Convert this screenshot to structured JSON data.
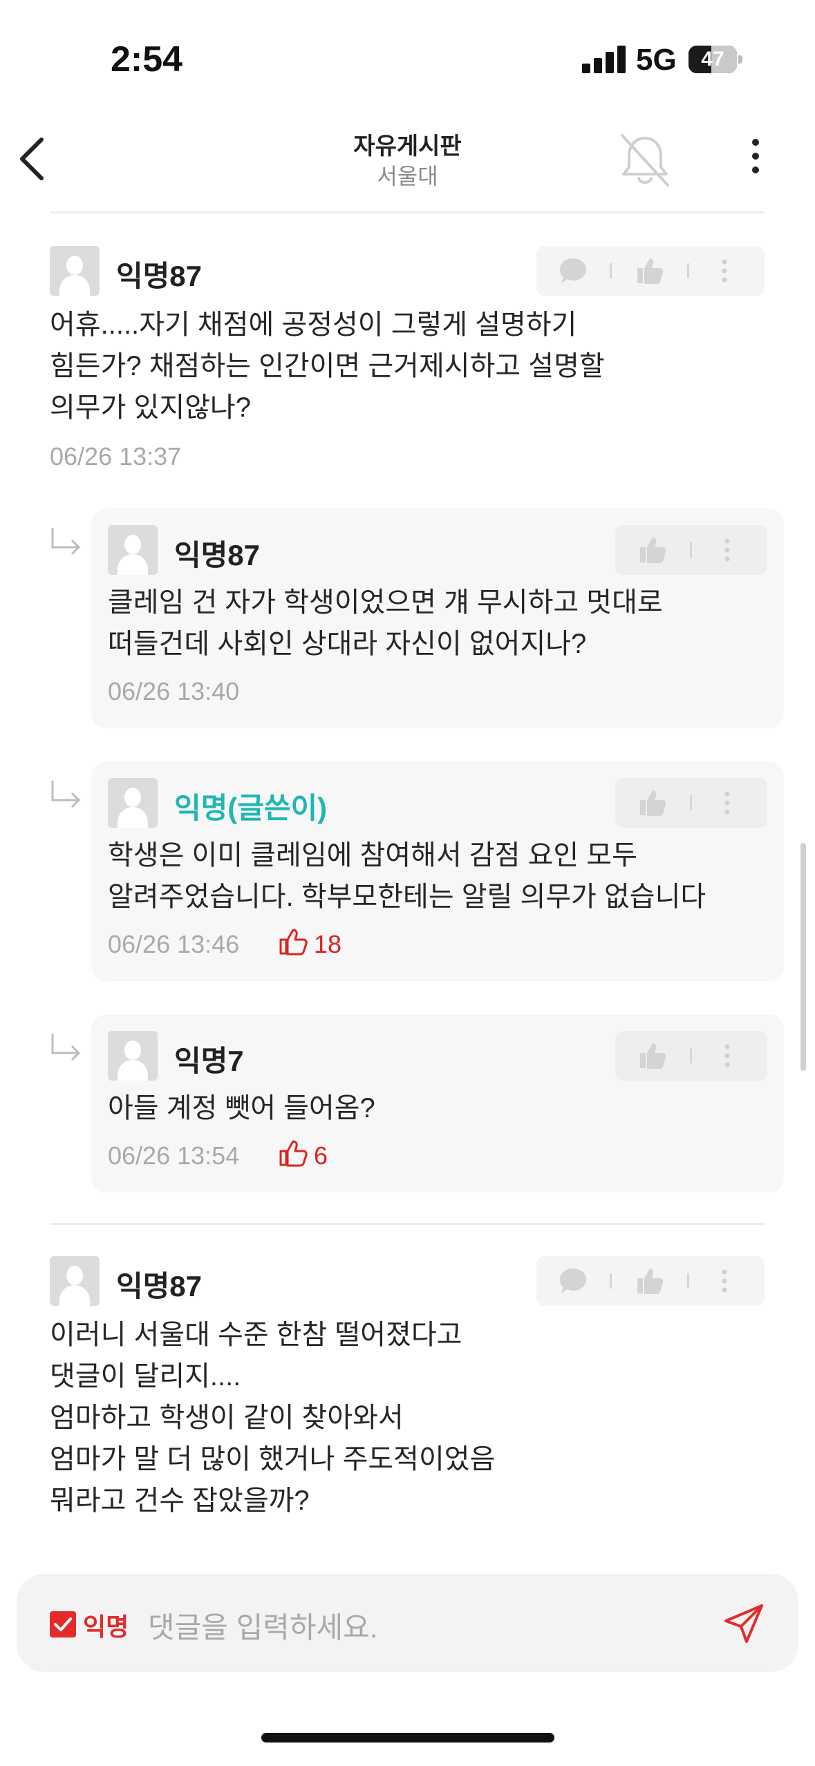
{
  "status_bar": {
    "time": "2:54",
    "network": "5G",
    "battery": "47",
    "battery_level": 0.47
  },
  "header": {
    "title": "자유게시판",
    "subtitle": "서울대"
  },
  "input": {
    "anon_label": "익명",
    "placeholder": "댓글을 입력하세요."
  },
  "comments": [
    {
      "nick": "익명87",
      "text": "어휴.....자기 채점에 공정성이 그렇게 설명하기\n힘든가? 채점하는 인간이면 근거제시하고 설명할\n의무가 있지않나?",
      "time": "06/26 13:37"
    },
    {
      "nick": "익명87",
      "text": "클레임 건 자가 학생이었으면 걔 무시하고 멋대로\n떠들건데 사회인 상대라 자신이 없어지나?",
      "time": "06/26 13:40"
    },
    {
      "nick": "익명(글쓴이)",
      "text": "학생은 이미 클레임에 참여해서 감점 요인 모두\n알려주었습니다. 학부모한테는 알릴 의무가 없습니다",
      "time": "06/26 13:46",
      "likes": "18"
    },
    {
      "nick": "익명7",
      "text": "아들 계정 뺏어 들어옴?",
      "time": "06/26 13:54",
      "likes": "6"
    },
    {
      "nick": "익명87",
      "text": "이러니 서울대 수준 한참 떨어졌다고\n댓글이 달리지....\n엄마하고 학생이  같이 찾아와서\n엄마가 말 더 많이 했거나 주도적이었음\n뭐라고 건수 잡았을까?"
    }
  ]
}
